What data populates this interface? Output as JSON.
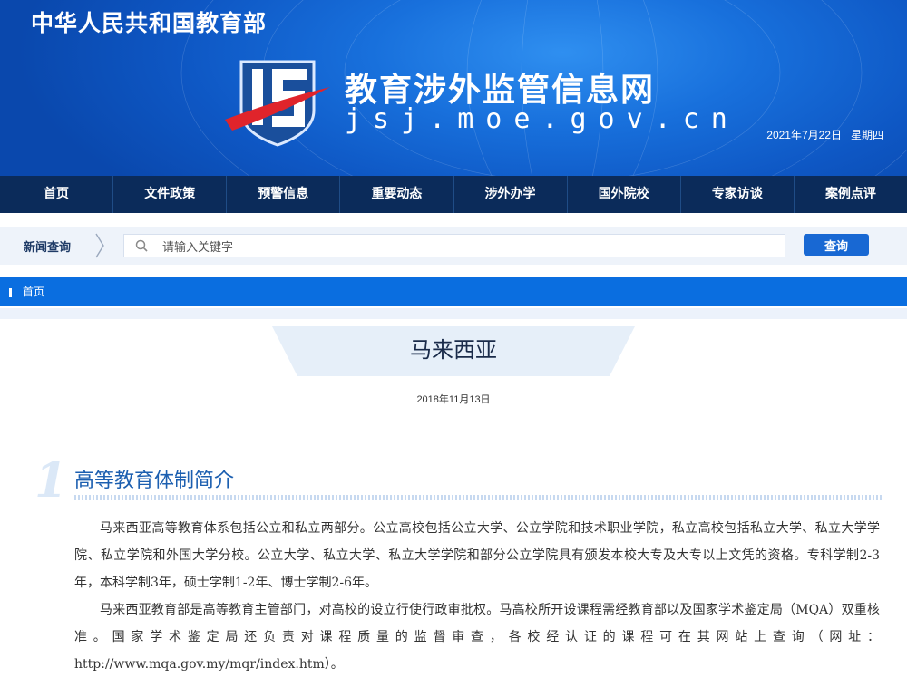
{
  "header": {
    "ministry": "中华人民共和国教育部",
    "site_title": "教育涉外监管信息网",
    "site_domain": "jsj.moe.gov.cn",
    "date": "2021年7月22日",
    "weekday": "星期四"
  },
  "nav": {
    "items": [
      {
        "label": "首页"
      },
      {
        "label": "文件政策"
      },
      {
        "label": "预警信息"
      },
      {
        "label": "重要动态"
      },
      {
        "label": "涉外办学"
      },
      {
        "label": "国外院校"
      },
      {
        "label": "专家访谈"
      },
      {
        "label": "案例点评"
      }
    ]
  },
  "search": {
    "label": "新闻查询",
    "placeholder": "请输入关键字",
    "button_label": "查询"
  },
  "breadcrumb": {
    "home": "首页"
  },
  "article": {
    "title": "马来西亚",
    "date": "2018年11月13日",
    "section_number": "1",
    "section_title": "高等教育体制简介",
    "paragraphs": [
      "马来西亚高等教育体系包括公立和私立两部分。公立高校包括公立大学、公立学院和技术职业学院，私立高校包括私立大学、私立大学学院、私立学院和外国大学分校。公立大学、私立大学、私立大学学院和部分公立学院具有颁发本校大专及大专以上文凭的资格。专科学制2-3年，本科学制3年，硕士学制1-2年、博士学制2-6年。",
      "马来西亚教育部是高等教育主管部门，对高校的设立行使行政审批权。马高校所开设课程需经教育部以及国家学术鉴定局（MQA）双重核准。国家学术鉴定局还负责对课程质量的监督审查，各校经认证的课程可在其网站上查询（网址：http://www.mqa.gov.my/mqr/index.htm）。"
    ]
  },
  "colors": {
    "nav_bg": "#0b2b5a",
    "accent_blue": "#0a6ee0",
    "button_blue": "#1868d3",
    "section_title": "#1c5fb0"
  },
  "icons": {
    "search": "magnifier-icon",
    "chevron": "chevron-right-icon",
    "logo": "jsj-shield-logo"
  }
}
